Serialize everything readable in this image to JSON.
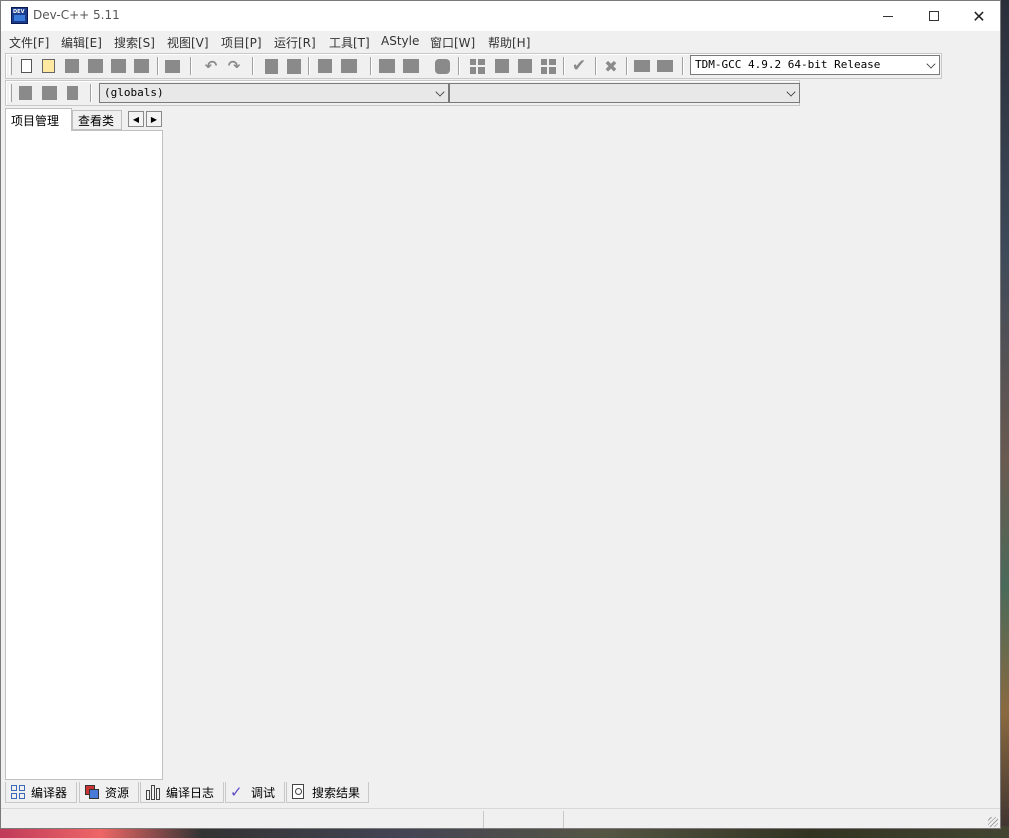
{
  "window": {
    "title": "Dev-C++ 5.11"
  },
  "menu": [
    "文件[F]",
    "编辑[E]",
    "搜索[S]",
    "视图[V]",
    "项目[P]",
    "运行[R]",
    "工具[T]",
    "AStyle",
    "窗口[W]",
    "帮助[H]"
  ],
  "toolbar": {
    "compiler_select": "TDM-GCC 4.9.2 64-bit Release",
    "scope_select": "(globals)",
    "member_select": ""
  },
  "left_tabs": {
    "project": "项目管理",
    "classes": "查看类"
  },
  "bottom_tabs": [
    "编译器",
    "资源",
    "编译日志",
    "调试",
    "搜索结果"
  ],
  "colors": {
    "chrome": "#f0f0f0",
    "icon_grey": "#8a8a8a",
    "app_icon": "#1a3c8c"
  }
}
